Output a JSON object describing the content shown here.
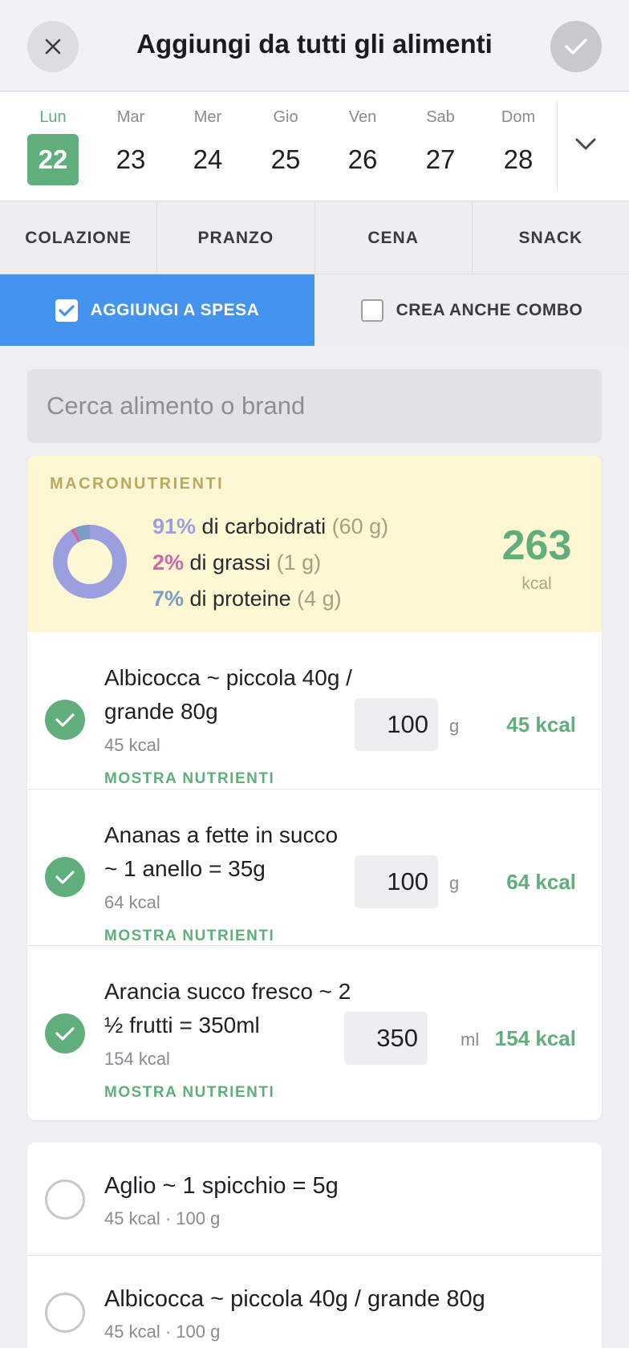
{
  "header": {
    "title": "Aggiungi da tutti gli alimenti",
    "close_icon": "close-icon",
    "confirm_icon": "checkmark-icon"
  },
  "week": {
    "days": [
      {
        "name": "Lun",
        "num": "22"
      },
      {
        "name": "Mar",
        "num": "23"
      },
      {
        "name": "Mer",
        "num": "24"
      },
      {
        "name": "Gio",
        "num": "25"
      },
      {
        "name": "Ven",
        "num": "26"
      },
      {
        "name": "Sab",
        "num": "27"
      },
      {
        "name": "Dom",
        "num": "28"
      }
    ],
    "selected": "Lun 22",
    "expand_icon": "chevron-down-icon"
  },
  "meals": [
    "COLAZIONE",
    "PRANZO",
    "CENA",
    "SNACK"
  ],
  "options": {
    "add_to_shopping": {
      "label": "AGGIUNGI A SPESA",
      "checked": true
    },
    "create_combo": {
      "label": "CREA ANCHE COMBO",
      "checked": false
    }
  },
  "search": {
    "placeholder": "Cerca alimento o brand",
    "value": ""
  },
  "macros": {
    "label": "MACRONUTRIENTI",
    "carbs": {
      "pct": "91%",
      "text": " di carboidrati ",
      "grams": "(60 g)",
      "color": "#9b9fe0",
      "share": 0.91
    },
    "fat": {
      "pct": "2%",
      "text": " di grassi ",
      "grams": "(1 g)",
      "color": "#cc6aa3",
      "share": 0.02
    },
    "protein": {
      "pct": "7%",
      "text": " di proteine ",
      "grams": "(4 g)",
      "color": "#7b9cc4",
      "share": 0.07
    },
    "kcal": "263",
    "kcal_unit": "kcal"
  },
  "selected_items": [
    {
      "name": "Albicocca ~ piccola 40g / grande 80g",
      "sub": "45 kcal",
      "show": "MOSTRA NUTRIENTI",
      "qty": "100",
      "unit": "g",
      "kcal": "45 kcal"
    },
    {
      "name": "Ananas a fette in succo ~ 1 anello = 35g",
      "sub": "64 kcal",
      "show": "MOSTRA NUTRIENTI",
      "qty": "100",
      "unit": "g",
      "kcal": "64 kcal"
    },
    {
      "name": "Arancia succo fresco ~ 2 ½ frutti = 350ml",
      "sub": "154 kcal",
      "show": "MOSTRA NUTRIENTI",
      "qty": "350",
      "unit": "ml",
      "kcal": "154 kcal"
    }
  ],
  "other_items": [
    {
      "name": "Aglio ~ 1 spicchio = 5g",
      "sub": "45 kcal · 100 g"
    },
    {
      "name": "Albicocca ~ piccola 40g / grande 80g",
      "sub": "45 kcal · 100 g"
    }
  ],
  "colors": {
    "accent_green": "#5fae7b",
    "accent_blue": "#4493ee",
    "macro_bg": "#fdf7d3"
  }
}
